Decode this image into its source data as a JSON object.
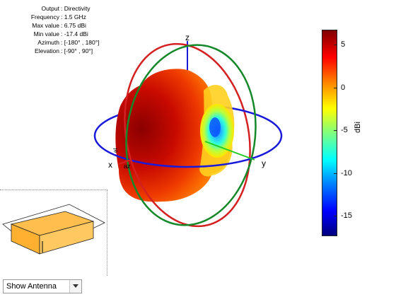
{
  "info": [
    {
      "key": "Output",
      "value": ": Directivity"
    },
    {
      "key": "Frequency",
      "value": ": 1.5 GHz"
    },
    {
      "key": "Max value",
      "value": ": 6.75 dBi"
    },
    {
      "key": "Min value",
      "value": ": -17.4 dBi"
    },
    {
      "key": "Azimuth",
      "value": ": [-180° , 180°]"
    },
    {
      "key": "Elevation",
      "value": ": [-90° , 90°]"
    }
  ],
  "axes": {
    "x": "x",
    "y": "y",
    "z": "z",
    "az": "az",
    "el": "el"
  },
  "colorbar": {
    "unit": "dBi",
    "min": -17.4,
    "max": 6.75,
    "ticks": [
      "5",
      "0",
      "-5",
      "-10",
      "-15"
    ],
    "tick_values": [
      5,
      0,
      -5,
      -10,
      -15
    ],
    "colormap": "jet"
  },
  "antenna_select": {
    "selected": "Show Antenna"
  },
  "colors": {
    "ring_xy": "#1a1adc",
    "ring_xz": "#d42020",
    "ring_yz": "#15882a",
    "antenna": "#ffbe4d"
  }
}
